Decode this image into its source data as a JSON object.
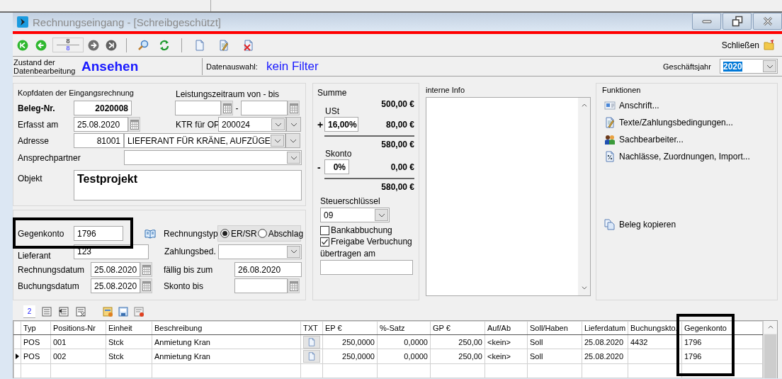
{
  "window": {
    "title": "Rechnungseingang - [Schreibgeschützt]"
  },
  "toolbar": {
    "record_current": "8",
    "record_total": "8",
    "close_label": "Schließen"
  },
  "status": {
    "state_label": "Zustand der Datenbearbeitung",
    "state": "Ansehen",
    "selection_label": "Datenauswahl:",
    "selection": "kein Filter",
    "year_label": "Geschäftsjahr",
    "year": "2020"
  },
  "header": {
    "title": "Kopfdaten der Eingangsrechnung",
    "period_label": "Leistungszeitraum von - bis",
    "period_separator": "-",
    "document_label": "Beleg-Nr.",
    "document_number": "2020008",
    "entered_label": "Erfasst am",
    "entered_date": "25.08.2020",
    "cost_unit_label": "KTR für OP",
    "cost_unit": "200024",
    "address_label": "Adresse",
    "address_number": "81001",
    "address_name": "LIEFERANT FÜR KRÄNE, AUFZÜGE",
    "contact_label": "Ansprechpartner",
    "object_label": "Objekt",
    "object": "Testprojekt"
  },
  "accounting": {
    "offset_account_label": "Gegenkonto",
    "offset_account": "1796",
    "invoice_type_label": "Rechnungstyp",
    "invoice_types": [
      {
        "label": "ER/SR",
        "selected": true
      },
      {
        "label": "Abschlag",
        "selected": false
      }
    ],
    "supplier_invoice_label": "Lieferant",
    "supplier_invoice": "123",
    "payment_terms_label": "Zahlungsbed.",
    "invoice_date_label": "Rechnungsdatum",
    "invoice_date": "25.08.2020",
    "due_label": "fällig bis zum",
    "due_date": "26.08.2020",
    "booking_date_label": "Buchungsdatum",
    "booking_date": "25.08.2020",
    "discount_until_label": "Skonto bis"
  },
  "totals": {
    "title": "Summe",
    "net": "500,00 €",
    "vat_label": "USt",
    "plus_sign": "+",
    "vat_rate": "16,00%",
    "vat_amount": "80,00 €",
    "gross": "580,00 €",
    "discount_label": "Skonto",
    "minus_sign": "-",
    "discount_rate": "0%",
    "discount_amount": "0,00 €",
    "total": "580,00 €",
    "tax_key_label": "Steuerschlüssel",
    "tax_key": "09",
    "checkboxes": [
      {
        "label": "Bankabbuchung",
        "checked": false
      },
      {
        "label": "Freigabe Verbuchung",
        "checked": true
      }
    ],
    "transferred_label": "übertragen am"
  },
  "internal_info": {
    "title": "interne Info"
  },
  "functions": {
    "title": "Funktionen",
    "items": [
      {
        "kind": "address",
        "label": "Anschrift..."
      },
      {
        "kind": "texts",
        "label": "Texte/Zahlungsbedingungen..."
      },
      {
        "kind": "people",
        "label": "Sachbearbeiter..."
      },
      {
        "kind": "percent",
        "label": "Nachlässe, Zuordnungen, Import..."
      }
    ],
    "copy_label": "Beleg kopieren"
  },
  "positions": {
    "count": "2",
    "columns": [
      "Typ",
      "Positions-Nr",
      "Einheit",
      "Beschreibung",
      "TXT",
      "EP €",
      "%-Satz",
      "GP €",
      "Auf/Ab",
      "Soll/Haben",
      "Lieferdatum",
      "Buchungskto.",
      "Gegenkonto"
    ],
    "rows": [
      {
        "selected": false,
        "type": "POS",
        "number": "001",
        "unit": "Stck",
        "description": "Anmietung Kran",
        "unit_price": "250,0000",
        "percent": "0,0000",
        "total": "250,00",
        "surcharge": "<kein>",
        "debit_credit": "Soll",
        "delivery_date": "25.08.2020",
        "booking_account": "4432",
        "offset_account": "1796"
      },
      {
        "selected": true,
        "type": "POS",
        "number": "002",
        "unit": "Stck",
        "description": "Anmietung Kran",
        "unit_price": "250,0000",
        "percent": "0,0000",
        "total": "250,00",
        "surcharge": "<kein>",
        "debit_credit": "Soll",
        "delivery_date": "25.08.2020",
        "offset_account": "1796"
      }
    ]
  }
}
